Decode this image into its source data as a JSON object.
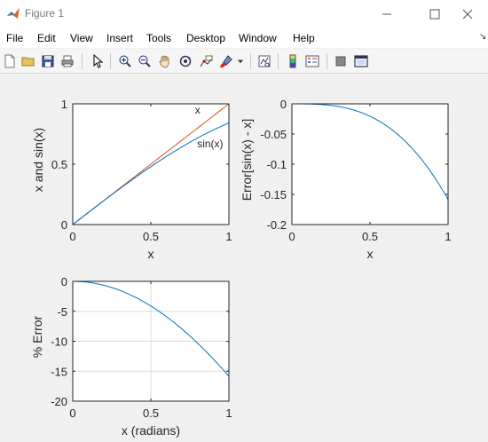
{
  "window": {
    "title": "Figure 1",
    "minimize_glyph": "—",
    "maximize_glyph": "☐",
    "close_glyph": "✕"
  },
  "menu": [
    "File",
    "Edit",
    "View",
    "Insert",
    "Tools",
    "Desktop",
    "Window",
    "Help"
  ],
  "toolbar": {
    "buttons": [
      "new-file-icon",
      "open-folder-icon",
      "save-icon",
      "print-icon",
      "pointer-icon",
      "zoom-in-icon",
      "zoom-out-icon",
      "pan-hand-icon",
      "rotate-3d-icon",
      "data-cursor-icon",
      "brush-icon",
      "brush-dropdown-icon",
      "link-plot-icon",
      "colorbar-icon",
      "legend-icon",
      "hide-plot-tools-icon",
      "show-plot-tools-icon"
    ]
  },
  "colors": {
    "blue_series": "#0072bd",
    "orange_series": "#d95319",
    "grid": "#dcdcdc"
  },
  "chart_data": [
    {
      "type": "line",
      "xlabel": "x",
      "ylabel": "x and sin(x)",
      "xlim": [
        0,
        1
      ],
      "ylim": [
        0,
        1
      ],
      "xticks": [
        "0",
        "0.5",
        "1"
      ],
      "yticks": [
        "0",
        "0.5",
        "1"
      ],
      "grid": false,
      "series": [
        {
          "name": "x",
          "function": "x",
          "x": [
            0,
            0.1,
            0.2,
            0.3,
            0.4,
            0.5,
            0.6,
            0.7,
            0.8,
            0.9,
            1.0
          ],
          "y": [
            0,
            0.1,
            0.2,
            0.3,
            0.4,
            0.5,
            0.6,
            0.7,
            0.8,
            0.9,
            1.0
          ],
          "color": "#d95319"
        },
        {
          "name": "sin(x)",
          "function": "sin",
          "x": [
            0,
            0.1,
            0.2,
            0.3,
            0.4,
            0.5,
            0.6,
            0.7,
            0.8,
            0.9,
            1.0
          ],
          "y": [
            0,
            0.0998,
            0.1987,
            0.2955,
            0.3894,
            0.4794,
            0.5646,
            0.6442,
            0.7174,
            0.7833,
            0.8415
          ],
          "color": "#0072bd"
        }
      ],
      "annotations": [
        {
          "text": "x",
          "at": [
            0.8,
            0.95
          ]
        },
        {
          "text": "sin(x)",
          "at": [
            0.88,
            0.67
          ]
        }
      ]
    },
    {
      "type": "line",
      "xlabel": "x",
      "ylabel": "Error[sin(x) - x]",
      "xlim": [
        0,
        1
      ],
      "ylim": [
        -0.2,
        0
      ],
      "xticks": [
        "0",
        "0.5",
        "1"
      ],
      "yticks": [
        "-0.2",
        "-0.15",
        "-0.1",
        "-0.05",
        "0"
      ],
      "grid": false,
      "series": [
        {
          "function": "sinx_minus_x",
          "x": [
            0,
            0.1,
            0.2,
            0.3,
            0.4,
            0.5,
            0.6,
            0.7,
            0.8,
            0.9,
            1.0
          ],
          "y": [
            0,
            -0.0002,
            -0.0013,
            -0.0045,
            -0.0106,
            -0.0206,
            -0.0354,
            -0.0558,
            -0.0826,
            -0.1167,
            -0.1585
          ],
          "color": "#0072bd"
        }
      ]
    },
    {
      "type": "line",
      "xlabel": "x (radians)",
      "ylabel": "% Error",
      "xlim": [
        0,
        1
      ],
      "ylim": [
        -20,
        0
      ],
      "xticks": [
        "0",
        "0.5",
        "1"
      ],
      "yticks": [
        "-20",
        "-15",
        "-10",
        "-5",
        "0"
      ],
      "grid": true,
      "series": [
        {
          "function": "percent_error",
          "x": [
            0,
            0.1,
            0.2,
            0.3,
            0.4,
            0.5,
            0.6,
            0.7,
            0.8,
            0.9,
            1.0
          ],
          "y": [
            0,
            -0.17,
            -0.67,
            -1.5,
            -2.67,
            -4.12,
            -5.9,
            -7.97,
            -10.33,
            -12.97,
            -15.85
          ],
          "color": "#0072bd"
        }
      ]
    }
  ]
}
